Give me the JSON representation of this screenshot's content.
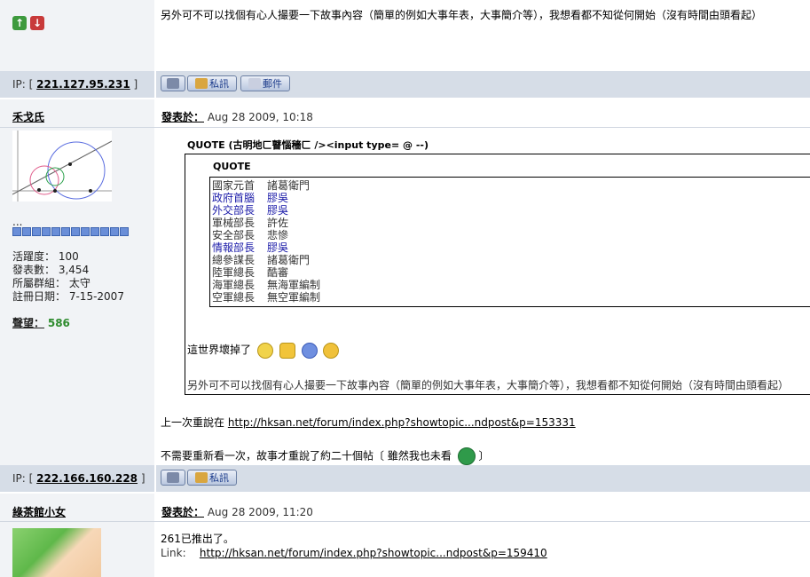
{
  "post1": {
    "tail_text": "另外可不可以找個有心人撮要一下故事內容（簡單的例如大事年表，大事簡介等），我想看都不知從何開始（沒有時間由頭看起）",
    "ip_label": "IP: [",
    "ip": "221.127.95.231",
    "ip_close": "]",
    "buttons": {
      "pm": "私訊",
      "mail": "郵件"
    }
  },
  "post2": {
    "username": "禾戈氏",
    "posted_label": "發表於：",
    "posted_date": "Aug 28 2009, 10:18",
    "user_dots": "...",
    "stats": {
      "activity_label": "活躍度：",
      "activity": "100",
      "posts_label": "發表數：",
      "posts": "3,454",
      "group_label": "所屬群組：",
      "group": "太守",
      "reg_label": "註冊日期：",
      "reg": "7-15-2007",
      "rep_label": "聲望：",
      "rep": "586"
    },
    "quote_outer_label": "QUOTE (古明地ㄈ瞽惱穡ㄈ /><input type= @ --)",
    "quote_inner_label": "QUOTE",
    "cabinet": [
      {
        "title": "國家元首",
        "name": "諸葛衛門",
        "blue": false
      },
      {
        "title": "政府首腦",
        "name": "膠吳",
        "blue": true
      },
      {
        "title": "外交部長",
        "name": "膠吳",
        "blue": true
      },
      {
        "title": "軍械部長",
        "name": "許佐",
        "blue": false
      },
      {
        "title": "安全部長",
        "name": "悲慘",
        "blue": false
      },
      {
        "title": "情報部長",
        "name": "膠吳",
        "blue": true
      },
      {
        "title": "總參謀長",
        "name": "諸葛衛門",
        "blue": false
      },
      {
        "title": "陸軍總長",
        "name": "酷審",
        "blue": false
      },
      {
        "title": "海軍總長",
        "name": "無海軍編制",
        "blue": false
      },
      {
        "title": "空軍總長",
        "name": "無空軍編制",
        "blue": false
      }
    ],
    "world_broken": "這世界壞掉了",
    "quote_tail": "另外可不可以找個有心人撮要一下故事內容（簡單的例如大事年表，大事簡介等），我想看都不知從何開始（沒有時間由頭看起）",
    "last_retell_label": "上一次重說在",
    "last_retell_link": "http://hksan.net/forum/index.php?showtopic...ndpost&p=153331",
    "no_reread": "不需要重新看一次，故事才重說了約二十個帖〔 雖然我也未看",
    "no_reread_close": "〕",
    "ip_label": "IP: [",
    "ip": "222.166.160.228",
    "ip_close": "]",
    "buttons": {
      "pm": "私訊"
    }
  },
  "post3": {
    "username": "綠茶館小女",
    "posted_label": "發表於：",
    "posted_date": "Aug 28 2009, 11:20",
    "body": "261已推出了。",
    "link_label": "Link:",
    "link": "http://hksan.net/forum/index.php?showtopic...ndpost&p=159410"
  }
}
